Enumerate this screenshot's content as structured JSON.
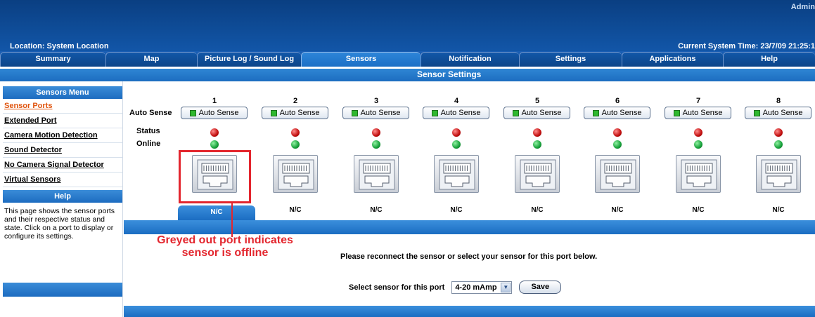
{
  "header": {
    "admin": "Admin",
    "location": "Location: System Location",
    "system_time": "Current System Time: 23/7/09 21:25:1"
  },
  "tabs": [
    {
      "label": "Summary"
    },
    {
      "label": "Map"
    },
    {
      "label": "Picture Log / Sound Log"
    },
    {
      "label": "Sensors",
      "active": true
    },
    {
      "label": "Notification"
    },
    {
      "label": "Settings"
    },
    {
      "label": "Applications"
    },
    {
      "label": "Help"
    }
  ],
  "page_title": "Sensor Settings",
  "sidebar": {
    "menu_title": "Sensors Menu",
    "items": [
      {
        "label": "Sensor Ports",
        "active": true
      },
      {
        "label": "Extended Port"
      },
      {
        "label": "Camera Motion Detection"
      },
      {
        "label": "Sound Detector"
      },
      {
        "label": "No Camera Signal Detector"
      },
      {
        "label": "Virtual Sensors"
      }
    ],
    "help_title": "Help",
    "help_text": "This page shows the sensor ports and their respective status and state. Click on a port to display or configure its settings."
  },
  "grid": {
    "row_labels": {
      "auto_sense": "Auto Sense",
      "status": "Status",
      "online": "Online"
    },
    "auto_sense_label": "Auto Sense",
    "ports": [
      {
        "number": "1",
        "state": "N/C",
        "status": "red",
        "online": "green"
      },
      {
        "number": "2",
        "state": "N/C",
        "status": "red",
        "online": "green"
      },
      {
        "number": "3",
        "state": "N/C",
        "status": "red",
        "online": "green"
      },
      {
        "number": "4",
        "state": "N/C",
        "status": "red",
        "online": "green"
      },
      {
        "number": "5",
        "state": "N/C",
        "status": "red",
        "online": "green"
      },
      {
        "number": "6",
        "state": "N/C",
        "status": "red",
        "online": "green"
      },
      {
        "number": "7",
        "state": "N/C",
        "status": "red",
        "online": "green"
      },
      {
        "number": "8",
        "state": "N/C",
        "status": "red",
        "online": "green"
      }
    ]
  },
  "annotation": "Greyed out port indicates sensor is offline",
  "message": "Please reconnect the sensor or select your sensor for this port below.",
  "select_label": "Select sensor for this port",
  "select_value": "4-20 mAmp",
  "save_label": "Save",
  "colors": {
    "accent": "#1b6dc2",
    "header": "#0a3f82",
    "annotation": "#e3262e",
    "active_link": "#e0550f"
  }
}
